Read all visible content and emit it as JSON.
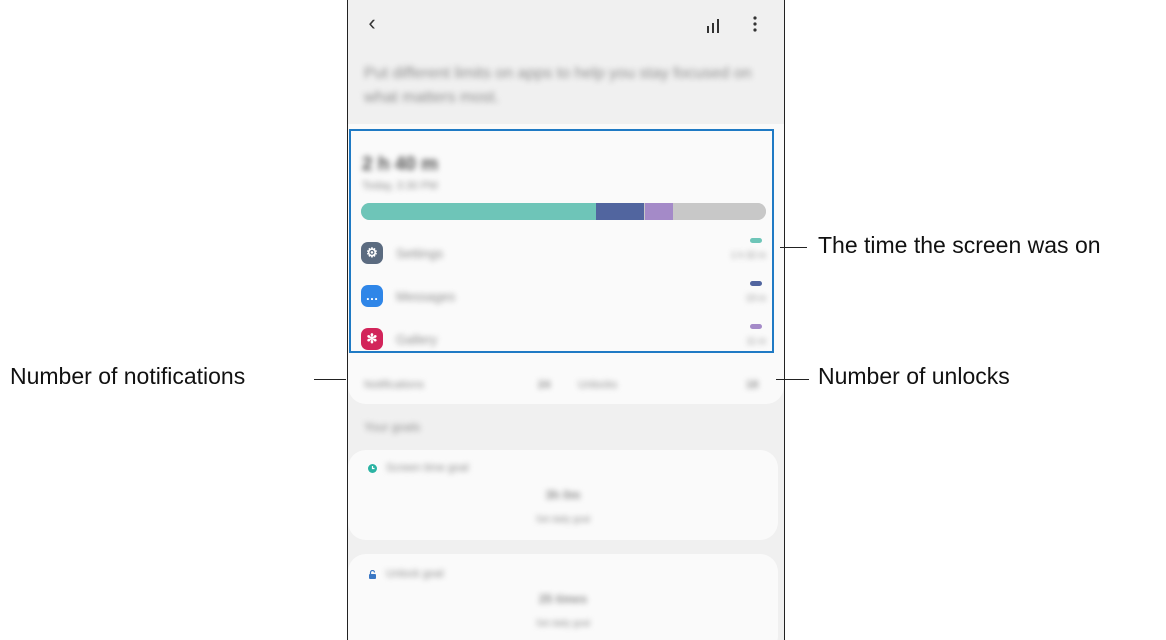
{
  "appbar": {
    "back_icon": "back-arrow-icon",
    "stats_icon": "bar-chart-icon",
    "more_icon": "more-vert-icon"
  },
  "intro_text": "Put different limits on apps to help you stay focused on what matters most.",
  "usage": {
    "total": "2 h 40 m",
    "total_sub": "Today, 3:30 PM",
    "bar": [
      {
        "name": "Settings",
        "fraction": 0.58,
        "color": "#6ec5b8"
      },
      {
        "name": "Messages",
        "fraction": 0.12,
        "color": "#51659f"
      },
      {
        "name": "Gallery",
        "fraction": 0.07,
        "color": "#a48ac8"
      },
      {
        "name": "Other",
        "fraction": 0.23,
        "color": "#c8c8c8"
      }
    ],
    "apps": [
      {
        "name": "Settings",
        "time": "1 h 32 m",
        "icon": "gear-icon",
        "icon_color": "#5b6b80",
        "pill_color": "#6ec5b8"
      },
      {
        "name": "Messages",
        "time": "19 m",
        "icon": "message-icon",
        "icon_color": "#2f86e8",
        "pill_color": "#51659f"
      },
      {
        "name": "Gallery",
        "time": "11 m",
        "icon": "flower-icon",
        "icon_color": "#d2245a",
        "pill_color": "#a48ac8"
      }
    ],
    "notifications_label": "Notifications",
    "notifications_value": "24",
    "unlocks_label": "Unlocks",
    "unlocks_value": "18"
  },
  "section_title": "Your goals",
  "goals": [
    {
      "title": "Screen time goal",
      "value": "3h 0m",
      "sub": "Set daily goal",
      "icon": "clock-icon",
      "icon_color": "#2bb3a3"
    },
    {
      "title": "Unlock goal",
      "value": "25 times",
      "sub": "Set daily goal",
      "icon": "lock-icon",
      "icon_color": "#3a77c4"
    }
  ],
  "callouts": {
    "screen_time": "The time the screen was on",
    "notifications": "Number of notifications",
    "unlocks": "Number of unlocks"
  }
}
